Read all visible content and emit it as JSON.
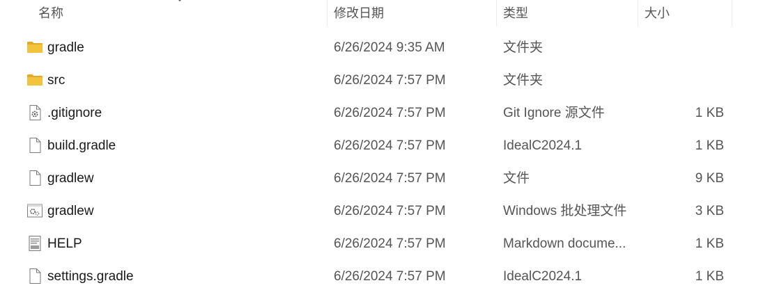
{
  "columns": {
    "name": "名称",
    "date": "修改日期",
    "type": "类型",
    "size": "大小"
  },
  "files": [
    {
      "name": "gradle",
      "date": "6/26/2024 9:35 AM",
      "type": "文件夹",
      "size": "",
      "icon": "folder-icon"
    },
    {
      "name": "src",
      "date": "6/26/2024 7:57 PM",
      "type": "文件夹",
      "size": "",
      "icon": "folder-icon"
    },
    {
      "name": ".gitignore",
      "date": "6/26/2024 7:57 PM",
      "type": "Git Ignore 源文件",
      "size": "1 KB",
      "icon": "config-file-icon"
    },
    {
      "name": "build.gradle",
      "date": "6/26/2024 7:57 PM",
      "type": "IdealC2024.1",
      "size": "1 KB",
      "icon": "file-icon"
    },
    {
      "name": "gradlew",
      "date": "6/26/2024 7:57 PM",
      "type": "文件",
      "size": "9 KB",
      "icon": "file-icon"
    },
    {
      "name": "gradlew",
      "date": "6/26/2024 7:57 PM",
      "type": "Windows 批处理文件",
      "size": "3 KB",
      "icon": "batch-file-icon"
    },
    {
      "name": "HELP",
      "date": "6/26/2024 7:57 PM",
      "type": "Markdown docume...",
      "size": "1 KB",
      "icon": "markdown-file-icon"
    },
    {
      "name": "settings.gradle",
      "date": "6/26/2024 7:57 PM",
      "type": "IdealC2024.1",
      "size": "1 KB",
      "icon": "file-icon"
    }
  ],
  "colors": {
    "folder": "#F4C33D",
    "header_text": "#555555",
    "row_text": "#1a1a1a"
  }
}
